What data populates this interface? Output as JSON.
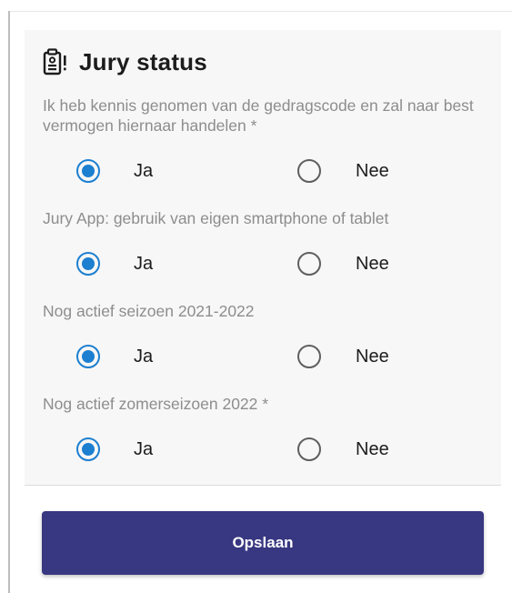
{
  "card": {
    "title": "Jury status",
    "header_icon": "clipboard-badge-alert-icon"
  },
  "questions": [
    {
      "label": "Ik heb kennis genomen van de gedragscode en zal naar best vermogen hiernaar handelen *",
      "options": [
        "Ja",
        "Nee"
      ],
      "selected": "Ja"
    },
    {
      "label": "Jury App: gebruik van eigen smartphone of tablet",
      "options": [
        "Ja",
        "Nee"
      ],
      "selected": "Ja"
    },
    {
      "label": "Nog actief seizoen 2021-2022",
      "options": [
        "Ja",
        "Nee"
      ],
      "selected": "Ja"
    },
    {
      "label": "Nog actief zomerseizoen 2022 *",
      "options": [
        "Ja",
        "Nee"
      ],
      "selected": "Ja"
    }
  ],
  "actions": {
    "save_label": "Opslaan"
  },
  "colors": {
    "accent": "#1d7fd0",
    "button": "#383781",
    "question_text": "#8d8d8d",
    "card_background": "#f7f7f7"
  }
}
